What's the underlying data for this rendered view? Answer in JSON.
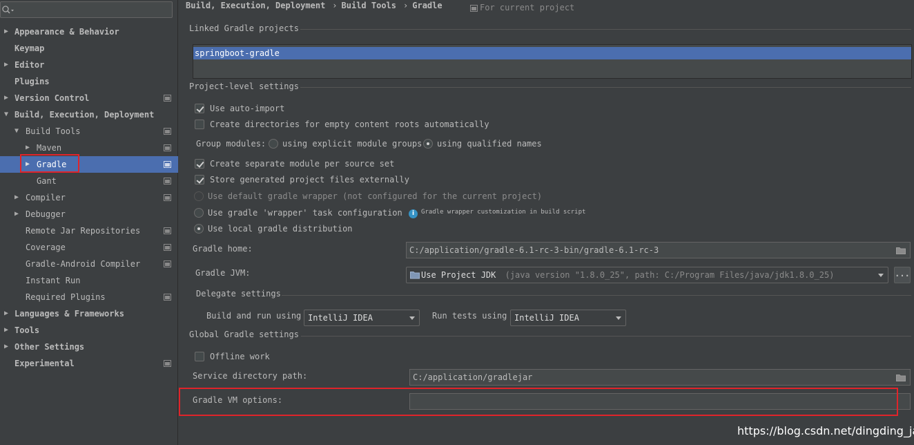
{
  "sidebar": {
    "search_placeholder": "",
    "items": [
      {
        "label": "Appearance & Behavior",
        "arrow": "▶"
      },
      {
        "label": "Keymap",
        "arrow": ""
      },
      {
        "label": "Editor",
        "arrow": "▶"
      },
      {
        "label": "Plugins",
        "arrow": ""
      },
      {
        "label": "Version Control",
        "arrow": "▶"
      },
      {
        "label": "Build, Execution, Deployment",
        "arrow": "▼"
      },
      {
        "label": "Build Tools",
        "arrow": "▼"
      },
      {
        "label": "Maven",
        "arrow": "▶"
      },
      {
        "label": "Gradle",
        "arrow": "▶"
      },
      {
        "label": "Gant",
        "arrow": ""
      },
      {
        "label": "Compiler",
        "arrow": "▶"
      },
      {
        "label": "Debugger",
        "arrow": "▶"
      },
      {
        "label": "Remote Jar Repositories",
        "arrow": ""
      },
      {
        "label": "Coverage",
        "arrow": ""
      },
      {
        "label": "Gradle-Android Compiler",
        "arrow": ""
      },
      {
        "label": "Instant Run",
        "arrow": ""
      },
      {
        "label": "Required Plugins",
        "arrow": ""
      },
      {
        "label": "Languages & Frameworks",
        "arrow": "▶"
      },
      {
        "label": "Tools",
        "arrow": "▶"
      },
      {
        "label": "Other Settings",
        "arrow": "▶"
      },
      {
        "label": "Experimental",
        "arrow": ""
      }
    ]
  },
  "breadcrumb": {
    "part1": "Build, Execution, Deployment",
    "part2": "Build Tools",
    "part3": "Gradle",
    "separator": "›",
    "scope": "For current project"
  },
  "linked": {
    "title": "Linked Gradle projects",
    "projects": [
      "springboot-gradle"
    ]
  },
  "project_level": {
    "title": "Project-level settings",
    "auto_import": "Use auto-import",
    "create_dirs": "Create directories for empty content roots automatically",
    "group_modules": "Group modules:",
    "explicit_groups": "using explicit module groups",
    "qualified_names": "using qualified names",
    "separate_module": "Create separate module per source set",
    "store_generated": "Store generated project files externally",
    "default_wrapper": "Use default gradle wrapper (not configured for the current project)",
    "wrapper_task": "Use gradle 'wrapper' task configuration",
    "wrapper_info": "Gradle wrapper customization in build script",
    "local_distribution": "Use local gradle distribution",
    "gradle_home_label": "Gradle home:",
    "gradle_home_value": "C:/application/gradle-6.1-rc-3-bin/gradle-6.1-rc-3",
    "gradle_jvm_label": "Gradle JVM:",
    "gradle_jvm_value": "Use Project JDK",
    "gradle_jvm_detail": "(java version \"1.8.0_25\", path: C:/Program Files/java/jdk1.8.0_25)",
    "ellipsis": "..."
  },
  "delegate": {
    "title": "Delegate settings",
    "build_run_label": "Build and run using",
    "build_run_value": "IntelliJ IDEA",
    "run_tests_label": "Run tests using",
    "run_tests_value": "IntelliJ IDEA"
  },
  "global": {
    "title": "Global Gradle settings",
    "offline": "Offline work",
    "service_dir_label": "Service directory path:",
    "service_dir_value": "C:/application/gradlejar",
    "vm_options_label": "Gradle VM options:",
    "vm_options_value": ""
  },
  "watermark": "https://blog.csdn.net/dingding_java",
  "colors": {
    "background": "#3c3f41",
    "selection": "#4b6eaf",
    "highlight_box": "#e0242a"
  }
}
